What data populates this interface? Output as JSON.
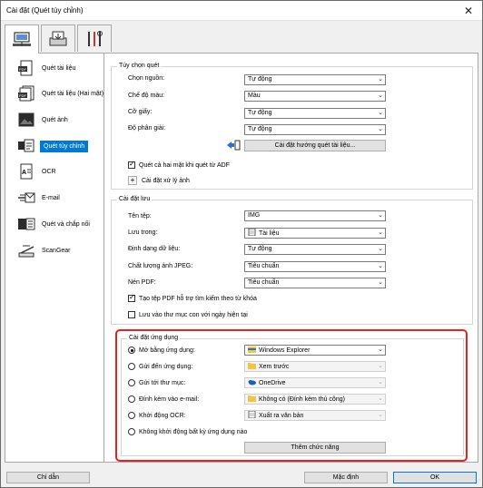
{
  "window": {
    "title": "Cài đặt (Quét tùy chỉnh)"
  },
  "top_tabs": [
    {
      "icon": "scan-from-computer-icon"
    },
    {
      "icon": "scan-from-panel-icon"
    },
    {
      "icon": "tools-icon"
    }
  ],
  "sidebar": {
    "items": [
      {
        "label": "Quét tài liệu",
        "icon": "pdf-document-icon",
        "selected": false
      },
      {
        "label": "Quét tài liệu (Hai mặt)",
        "icon": "pdf-duplex-document-icon",
        "selected": false
      },
      {
        "label": "Quét ảnh",
        "icon": "photo-icon",
        "selected": false
      },
      {
        "label": "Quét tùy chỉnh",
        "icon": "custom-scan-icon",
        "selected": true
      },
      {
        "label": "OCR",
        "icon": "ocr-icon",
        "selected": false
      },
      {
        "label": "E-mail",
        "icon": "email-icon",
        "selected": false
      },
      {
        "label": "Quét và chắp nối",
        "icon": "stitch-icon",
        "selected": false
      },
      {
        "label": "ScanGear",
        "icon": "scangear-icon",
        "selected": false
      }
    ]
  },
  "scan_options": {
    "title": "Tùy chọn quét",
    "source_label": "Chọn nguồn:",
    "source_value": "Tự động",
    "color_mode_label": "Chế độ màu:",
    "color_mode_value": "Màu",
    "paper_size_label": "Cỡ giấy:",
    "paper_size_value": "Tự động",
    "resolution_label": "Độ phân giải:",
    "resolution_value": "Tự động",
    "orientation_button": "Cài đặt hướng quét tài liệu...",
    "duplex_adf_label": "Quét cả hai mặt khi quét từ ADF",
    "duplex_adf_checked": true,
    "image_processing_label": "Cài đặt xử lý ảnh"
  },
  "save_settings": {
    "title": "Cài đặt lưu",
    "filename_label": "Tên tệp:",
    "filename_value": "IMG",
    "save_in_label": "Lưu trong:",
    "save_in_value": "Tài liệu",
    "format_label": "Định dạng dữ liệu:",
    "format_value": "Tự động",
    "jpeg_quality_label": "Chất lượng ảnh JPEG:",
    "jpeg_quality_value": "Tiêu chuẩn",
    "pdf_compression_label": "Nén PDF:",
    "pdf_compression_value": "Tiêu chuẩn",
    "searchable_pdf_label": "Tạo tệp PDF hỗ trợ tìm kiếm theo từ khóa",
    "searchable_pdf_checked": true,
    "subfolder_label": "Lưu vào thư mục con với ngày hiện tại",
    "subfolder_checked": false
  },
  "app_settings": {
    "title": "Cài đặt ứng dụng",
    "options": [
      {
        "label": "Mở bằng ứng dụng:",
        "value": "Windows Explorer",
        "selected": true,
        "enabled": true,
        "icon": "explorer-icon"
      },
      {
        "label": "Gửi đến ứng dụng:",
        "value": "Xem trước",
        "selected": false,
        "enabled": false,
        "icon": "folder-icon"
      },
      {
        "label": "Gửi tới thư mục:",
        "value": "OneDrive",
        "selected": false,
        "enabled": false,
        "icon": "onedrive-icon"
      },
      {
        "label": "Đính kèm vào e-mail:",
        "value": "Không có (Đính kèm thủ công)",
        "selected": false,
        "enabled": false,
        "icon": "folder-icon"
      },
      {
        "label": "Khởi động OCR:",
        "value": "Xuất ra văn bản",
        "selected": false,
        "enabled": false,
        "icon": "text-file-icon"
      }
    ],
    "no_app_label": "Không khởi động bất kỳ ứng dụng nào",
    "add_function_button": "Thêm chức năng"
  },
  "footer": {
    "help_button": "Chỉ dẫn",
    "defaults_button": "Mặc định",
    "ok_button": "OK"
  },
  "colors": {
    "accent": "#0078d7",
    "highlight": "#e8201e",
    "folder": "#f5c542"
  }
}
